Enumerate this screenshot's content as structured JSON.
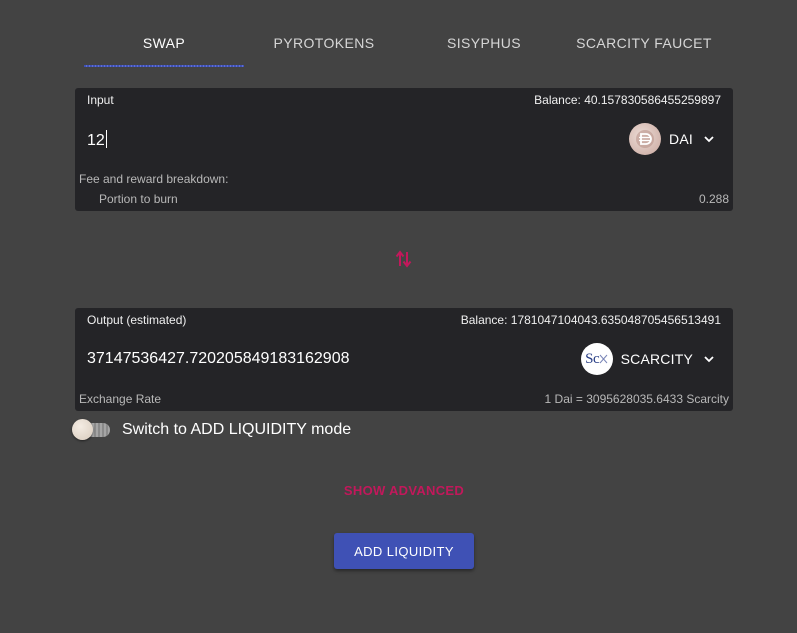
{
  "tabs": [
    {
      "label": "SWAP",
      "active": true
    },
    {
      "label": "PYROTOKENS",
      "active": false
    },
    {
      "label": "SISYPHUS",
      "active": false
    },
    {
      "label": "SCARCITY FAUCET",
      "active": false
    }
  ],
  "input": {
    "label": "Input",
    "balance": "Balance: 40.157830586455259897",
    "amount": "12",
    "token": {
      "name": "DAI",
      "icon": "dai-logo-icon"
    },
    "fee_title": "Fee and reward breakdown:",
    "burn_label": "Portion to burn",
    "burn_value": "0.288"
  },
  "output": {
    "label": "Output (estimated)",
    "balance": "Balance: 1781047104043.635048705456513491",
    "amount": "37147536427.720205849183162908",
    "token": {
      "name": "SCARCITY",
      "icon": "scarcity-logo-icon",
      "logo_text": "Sc"
    },
    "rate_label": "Exchange Rate",
    "rate_value": "1 Dai = 3095628035.6433 Scarcity"
  },
  "toggle": {
    "label": "Switch to ADD LIQUIDITY mode",
    "on": false
  },
  "show_advanced": "SHOW ADVANCED",
  "action_button": "ADD LIQUIDITY",
  "colors": {
    "background": "#434343",
    "panel": "#242427",
    "primary": "#3f51b5",
    "accent": "#c2185b"
  }
}
